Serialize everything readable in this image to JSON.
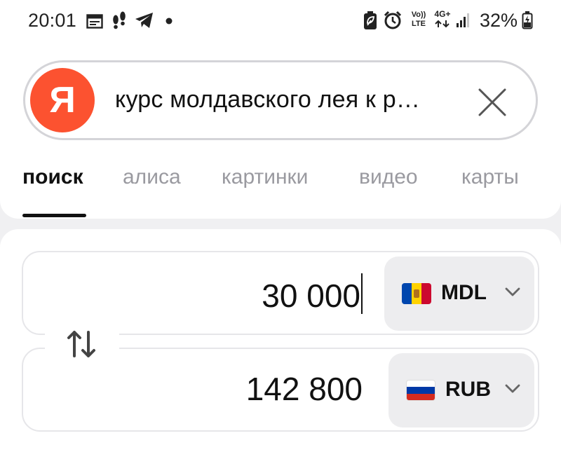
{
  "status_bar": {
    "time": "20:01",
    "battery": "32%",
    "network_labels": [
      "Vo)) LTE",
      "4G+"
    ],
    "icons": [
      "calendar-icon",
      "footsteps-icon",
      "telegram-icon",
      "dot-icon",
      "battery-saver-icon",
      "alarm-icon",
      "volte-icon",
      "4g-icon",
      "signal-icon",
      "battery-icon"
    ]
  },
  "search": {
    "logo_letter": "Я",
    "query": "курс молдавского лея к р…",
    "brand_color": "#fc5230"
  },
  "tabs": [
    {
      "label": "поиск",
      "active": true
    },
    {
      "label": "алиса",
      "active": false
    },
    {
      "label": "картинки",
      "active": false
    },
    {
      "label": "видео",
      "active": false
    },
    {
      "label": "карты",
      "active": false
    }
  ],
  "converter": {
    "from": {
      "amount": "30 000",
      "currency": "MDL",
      "flag": "moldova-flag-icon"
    },
    "to": {
      "amount": "142 800",
      "currency": "RUB",
      "flag": "russia-flag-icon"
    },
    "swap_icon": "swap-arrows-icon"
  }
}
